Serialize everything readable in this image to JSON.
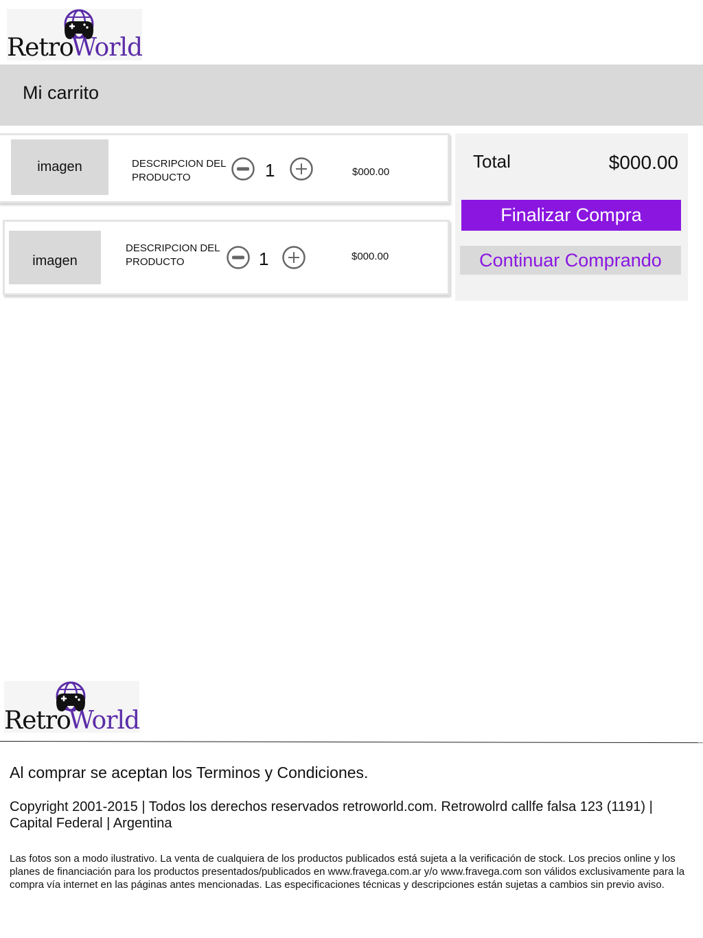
{
  "brand": {
    "name_part1": "Retro",
    "name_part2": "World",
    "accent_color": "#5b2ca8",
    "icon": "globe-gamepad-icon"
  },
  "header": {
    "title": "Mi carrito"
  },
  "cart": {
    "items": [
      {
        "image_label": "imagen",
        "description": "DESCRIPCION DEL PRODUCTO",
        "quantity": "1",
        "price": "$000.00"
      },
      {
        "image_label": "imagen",
        "description": "DESCRIPCION DEL PRODUCTO",
        "quantity": "1",
        "price": "$000.00"
      }
    ]
  },
  "summary": {
    "total_label": "Total",
    "total_value": "$000.00",
    "checkout_label": "Finalizar Compra",
    "continue_label": "Continuar Comprando",
    "button_color": "#8a16e0"
  },
  "footer": {
    "terms": "Al comprar se aceptan los Terminos y Condiciones.",
    "copyright": "Copyright 2001-2015 | Todos los derechos reservados retroworld.com. Retrowolrd  callfe falsa 123 (1191) | Capital Federal | Argentina",
    "disclaimer": "Las fotos son a modo ilustrativo. La venta de cualquiera de los productos publicados está sujeta a la verificación de stock. Los precios online y los planes de financiación para los productos presentados/publicados en www.fravega.com.ar y/o www.fravega.com son válidos exclusivamente para la compra vía internet en las páginas antes mencionadas. Las especificaciones técnicas y descripciones están sujetas a cambios sin previo aviso."
  }
}
